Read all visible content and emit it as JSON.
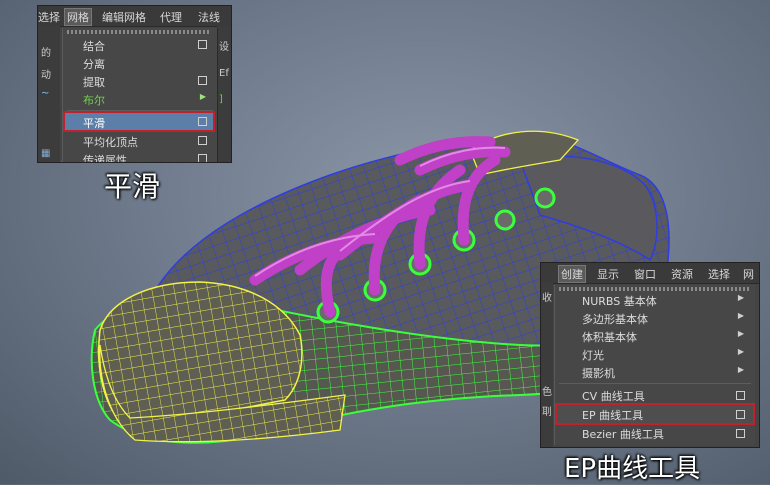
{
  "menu_smooth": {
    "menubar": [
      "选择",
      "网格",
      "编辑网格",
      "代理",
      "法线"
    ],
    "active_menu": "网格",
    "side_left": [
      "的",
      "动",
      "",
      ""
    ],
    "side_right": [
      "设",
      "Ef",
      "",
      ""
    ],
    "items": [
      {
        "label": "结合",
        "option_box": true
      },
      {
        "label": "分离",
        "option_box": false
      },
      {
        "label": "提取",
        "option_box": true
      },
      {
        "label": "布尔",
        "submenu": true
      },
      {
        "label": "平滑",
        "option_box": true,
        "highlighted": true
      },
      {
        "label": "平均化顶点",
        "option_box": true
      },
      {
        "label": "传递属性",
        "option_box": true
      }
    ]
  },
  "menu_curve": {
    "menubar": [
      "创建",
      "显示",
      "窗口",
      "资源",
      "选择",
      "网"
    ],
    "active_menu": "创建",
    "side_left": [
      "收",
      "",
      "色",
      "刵"
    ],
    "items": [
      {
        "label": "NURBS 基本体",
        "submenu": true
      },
      {
        "label": "多边形基本体",
        "submenu": true
      },
      {
        "label": "体积基本体",
        "submenu": true
      },
      {
        "label": "灯光",
        "submenu": true
      },
      {
        "label": "摄影机",
        "submenu": true
      },
      {
        "label": "CV 曲线工具",
        "option_box": true
      },
      {
        "label": "EP 曲线工具",
        "option_box": true,
        "highlighted": true
      },
      {
        "label": "Bezier 曲线工具",
        "option_box": true
      }
    ]
  },
  "captions": {
    "smooth": "平滑",
    "ep_curve": "EP曲线工具"
  },
  "colors": {
    "highlight_outline": "#c0212b",
    "selected_bg": "#5b7fa8",
    "wire_green": "#3cff3c",
    "wire_yellow": "#f2f24a",
    "wire_blue": "#2f3de0",
    "lace_magenta": "#c040c8",
    "shoe_body": "#5a5a5a"
  }
}
